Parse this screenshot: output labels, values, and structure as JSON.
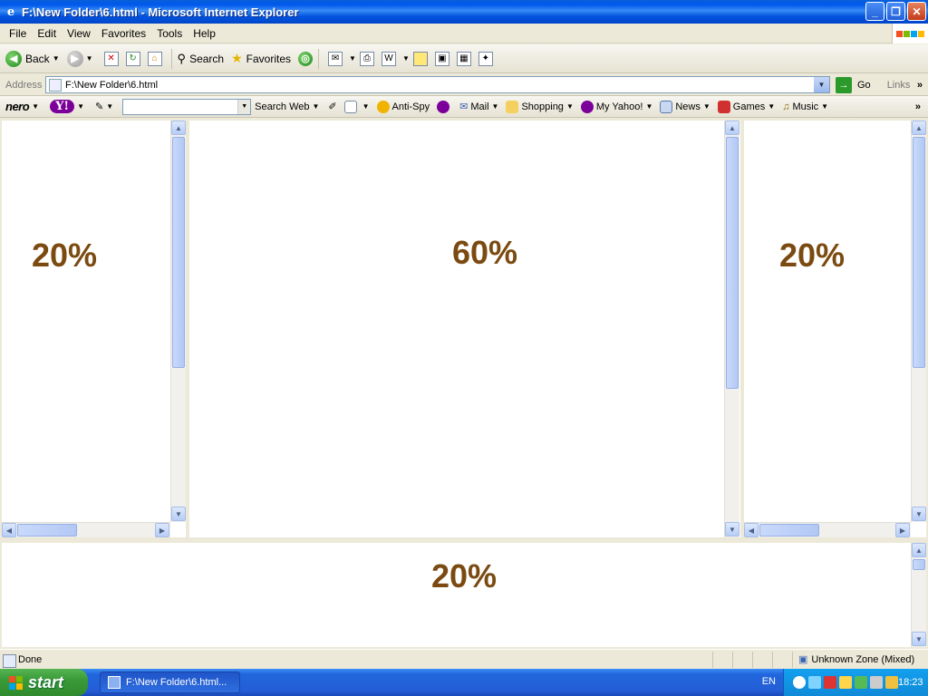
{
  "window": {
    "title": "F:\\New Folder\\6.html - Microsoft Internet Explorer",
    "buttons": {
      "minimize": "_",
      "maximize": "❐",
      "close": "✕"
    }
  },
  "menu": [
    "File",
    "Edit",
    "View",
    "Favorites",
    "Tools",
    "Help"
  ],
  "toolbar": {
    "back_label": "Back",
    "search_label": "Search",
    "favorites_label": "Favorites"
  },
  "address": {
    "label": "Address",
    "value": "F:\\New Folder\\6.html",
    "go_label": "Go",
    "links_label": "Links"
  },
  "yahoobar": {
    "nero_label": "nero",
    "yahoo_label": "Y!",
    "search_web_label": "Search Web",
    "antispy_label": "Anti-Spy",
    "mail_label": "Mail",
    "shopping_label": "Shopping",
    "myyahoo_label": "My Yahoo!",
    "news_label": "News",
    "games_label": "Games",
    "music_label": "Music"
  },
  "frames": {
    "left_label": "20%",
    "center_label": "60%",
    "right_label": "20%",
    "bottom_label": "20%"
  },
  "status": {
    "text": "Done",
    "zone": "Unknown Zone (Mixed)"
  },
  "taskbar": {
    "start_label": "start",
    "task_label": "F:\\New Folder\\6.html...",
    "language": "EN",
    "clock": "18:23"
  },
  "colors": {
    "frame_text": "#7a4a10",
    "title_bar": "#0058ee",
    "taskbar": "#245ed7",
    "start_button": "#3a9a38"
  }
}
